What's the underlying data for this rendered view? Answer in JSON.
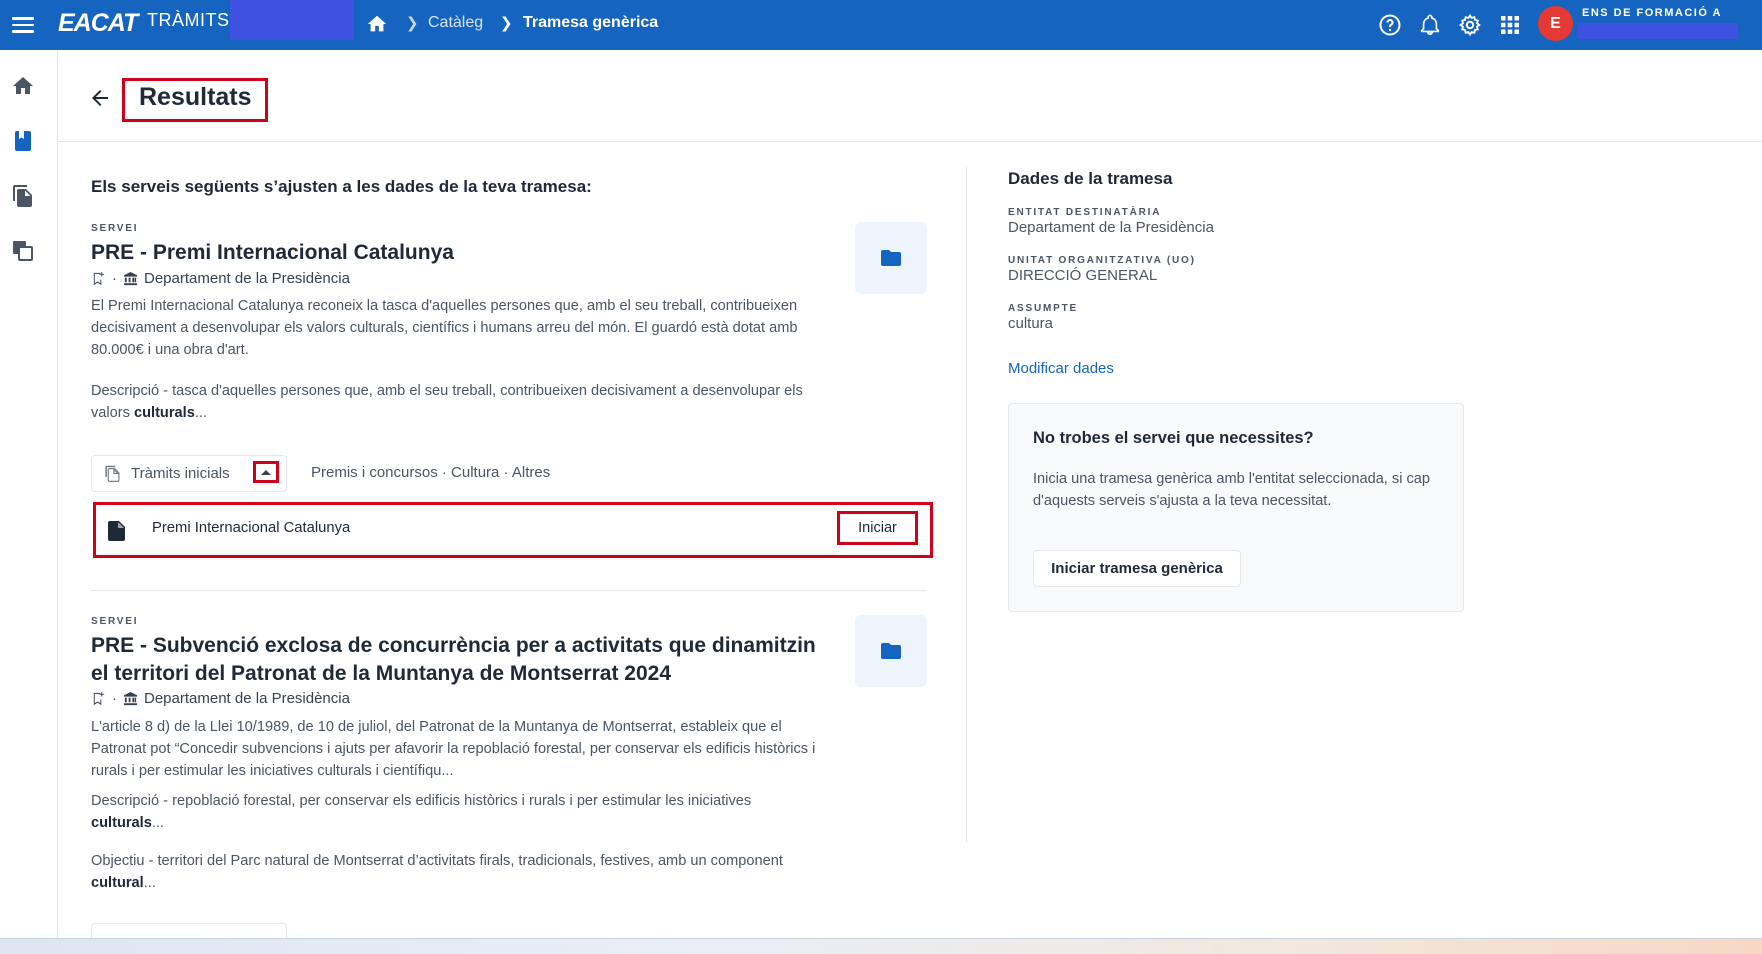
{
  "topbar": {
    "logo": "EACAT",
    "logo_sub": "TRÀMITS",
    "breadcrumb": [
      "Catàleg",
      "Tramesa genèrica"
    ],
    "avatar_letter": "E",
    "user_org": "ENS DE FORMACIÓ A",
    "icons": [
      "help-icon",
      "bell-icon",
      "gear-icon",
      "apps-grid-icon"
    ]
  },
  "sidebar": {
    "icons": [
      "home-icon",
      "book-icon",
      "documents-icon",
      "copy-icon"
    ]
  },
  "header": {
    "title": "Resultats"
  },
  "main": {
    "intro": "Els serveis següents s’ajusten a les dades de la teva tramesa:",
    "services": [
      {
        "overline": "SERVEI",
        "title": "PRE - Premi Internacional Catalunya",
        "department": "Departament de la Presidència",
        "description": "El Premi Internacional Catalunya reconeix la tasca d'aquelles persones que, amb el seu treball, contribueixen decisivament a desenvolupar els valors culturals, científics i humans arreu del món. El guardó està dotat amb 80.000€ i una obra d'art.",
        "desc_prefix": "Descripció - tasca d'aquelles persones que, amb el seu treball, contribueixen decisivament a desenvolupar els valors ",
        "desc_bold": "culturals",
        "desc_suffix": "...",
        "tramits_label": "Tràmits inicials",
        "tags": "Premis i concursos · Cultura · Altres",
        "tramit_name": "Premi Internacional Catalunya",
        "tramit_button": "Iniciar"
      },
      {
        "overline": "SERVEI",
        "title": "PRE - Subvenció exclosa de concurrència per a activitats que dinamitzin el territori del Patronat de la Muntanya de Montserrat 2024",
        "department": "Departament de la Presidència",
        "description": "L'article 8 d) de la Llei 10/1989, de 10 de juliol, del Patronat de la Muntanya de Montserrat, estableix que el Patronat pot “Concedir subvencions i ajuts per afavorir la repoblació forestal, per conservar els edificis històrics i rurals i per estimular les iniciatives culturals i científiqu...",
        "desc_prefix": "Descripció - repoblació forestal, per conservar els edificis històrics i rurals i per estimular les iniciatives ",
        "desc_bold": "culturals",
        "desc_suffix": "...",
        "obj_prefix": "Objectiu - territori del Parc natural de Montserrat d’activitats firals, tradicionals, festives, amb un component ",
        "obj_bold": "cultural",
        "obj_suffix": "..."
      }
    ]
  },
  "panel": {
    "title": "Dades de la tramesa",
    "fields": [
      {
        "label": "ENTITAT DESTINATÀRIA",
        "value": "Departament de la Presidència"
      },
      {
        "label": "UNITAT ORGANITZATIVA (UO)",
        "value": "DIRECCIÓ GENERAL"
      },
      {
        "label": "ASSUMPTE",
        "value": "cultura"
      }
    ],
    "modify_link": "Modificar dades",
    "help_title": "No trobes el servei que necessites?",
    "help_text": "Inicia una tramesa genèrica amb l'entitat seleccionada, si cap d'aquests serveis s'ajusta a la teva necessitat.",
    "help_button": "Iniciar tramesa genèrica"
  },
  "colors": {
    "topbar": "#1565c0",
    "highlight": "#d0021b",
    "avatar": "#e53935",
    "link": "#1565c0"
  }
}
